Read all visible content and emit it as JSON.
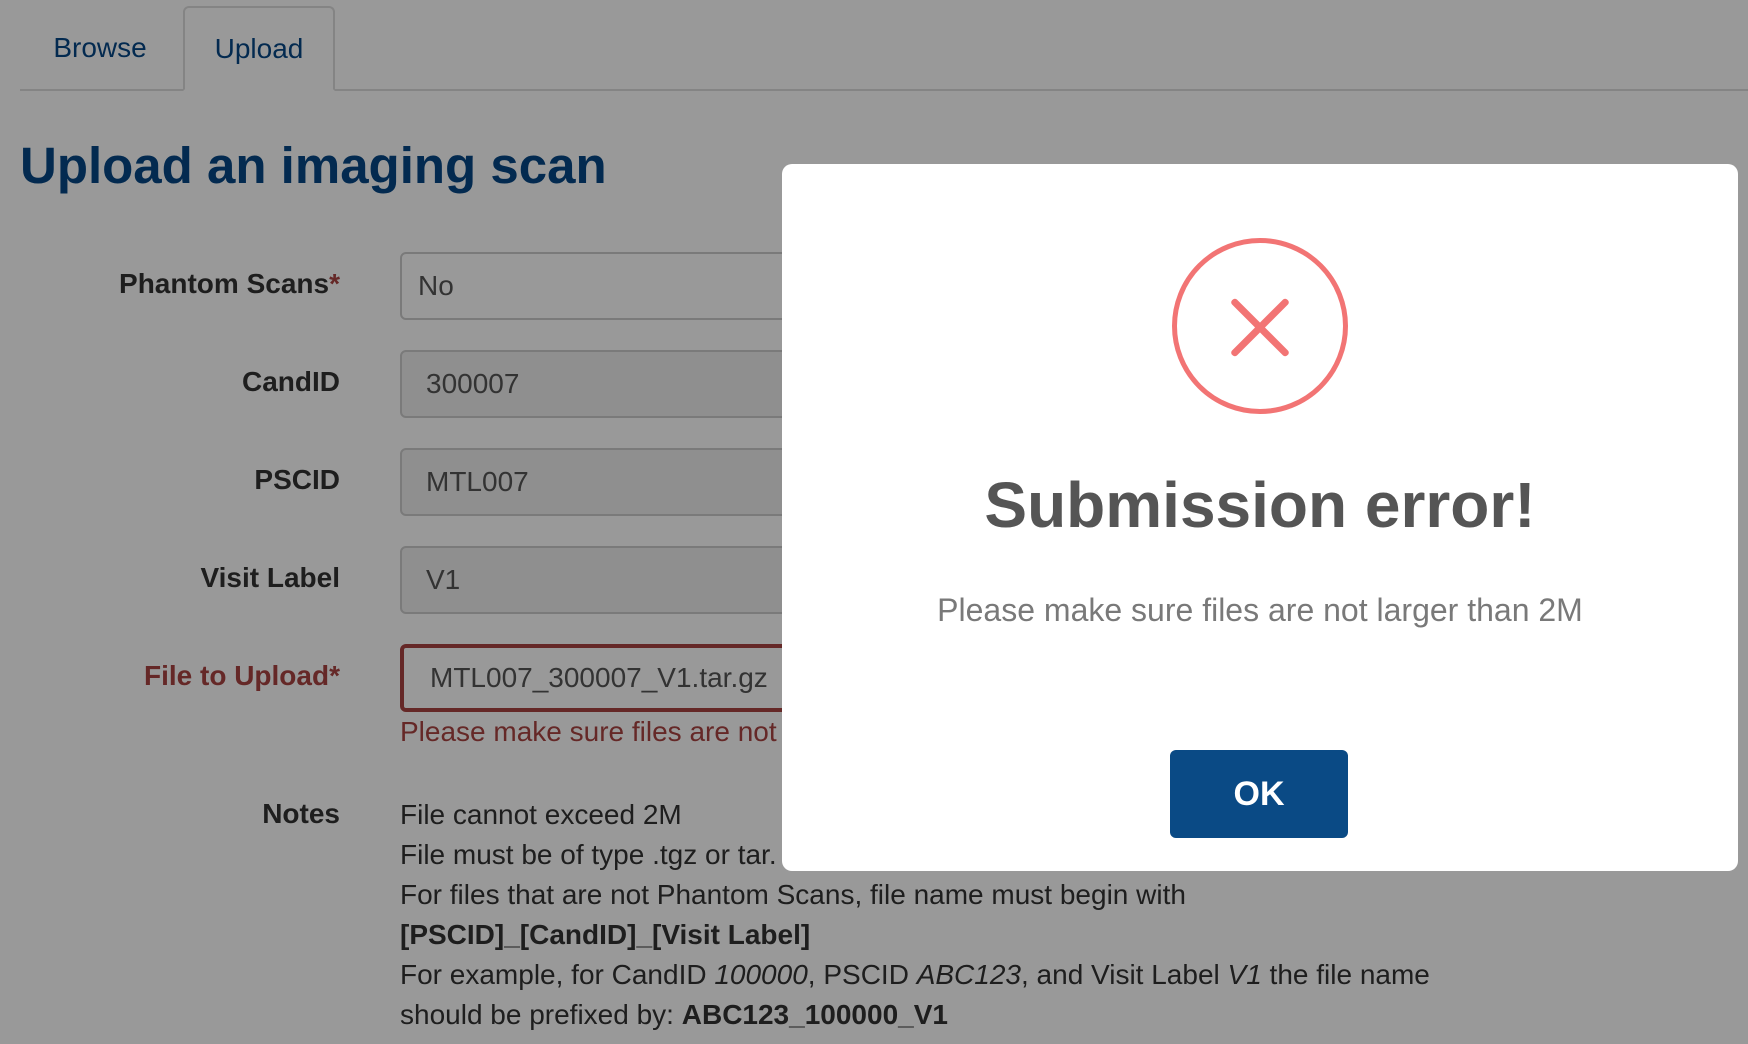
{
  "tabs": [
    {
      "label": "Browse"
    },
    {
      "label": "Upload"
    }
  ],
  "page_title": "Upload an imaging scan",
  "form": {
    "phantom": {
      "label": "Phantom Scans",
      "required_mark": "*",
      "value": "No"
    },
    "candid": {
      "label": "CandID",
      "value": "300007"
    },
    "pscid": {
      "label": "PSCID",
      "value": "MTL007"
    },
    "visit_label": {
      "label": "Visit Label",
      "value": "V1"
    },
    "file": {
      "label": "File to Upload",
      "required_mark": "*",
      "value": "MTL007_300007_V1.tar.gz",
      "error": "Please make sure files are not"
    },
    "notes": {
      "label": "Notes",
      "line1": "File cannot exceed 2M",
      "line2": "File must be of type .tgz or tar.",
      "line3": "For files that are not Phantom Scans, file name must begin with",
      "line4": "[PSCID]_[CandID]_[Visit Label]",
      "line5_a": "For example, for CandID ",
      "line5_b": "100000",
      "line5_c": ", PSCID ",
      "line5_d": "ABC123",
      "line5_e": ", and Visit Label ",
      "line5_f": "V1",
      "line5_g": " the file name",
      "line6_a": "should be prefixed by: ",
      "line6_b": "ABC123_100000_V1"
    }
  },
  "modal": {
    "icon": "error-x-icon",
    "title": "Submission error!",
    "message": "Please make sure files are not larger than 2M",
    "ok_label": "OK"
  },
  "colors": {
    "link_blue": "#064785",
    "error_red": "#a94442",
    "icon_red": "#f27474",
    "ok_button": "#0a4a85"
  }
}
